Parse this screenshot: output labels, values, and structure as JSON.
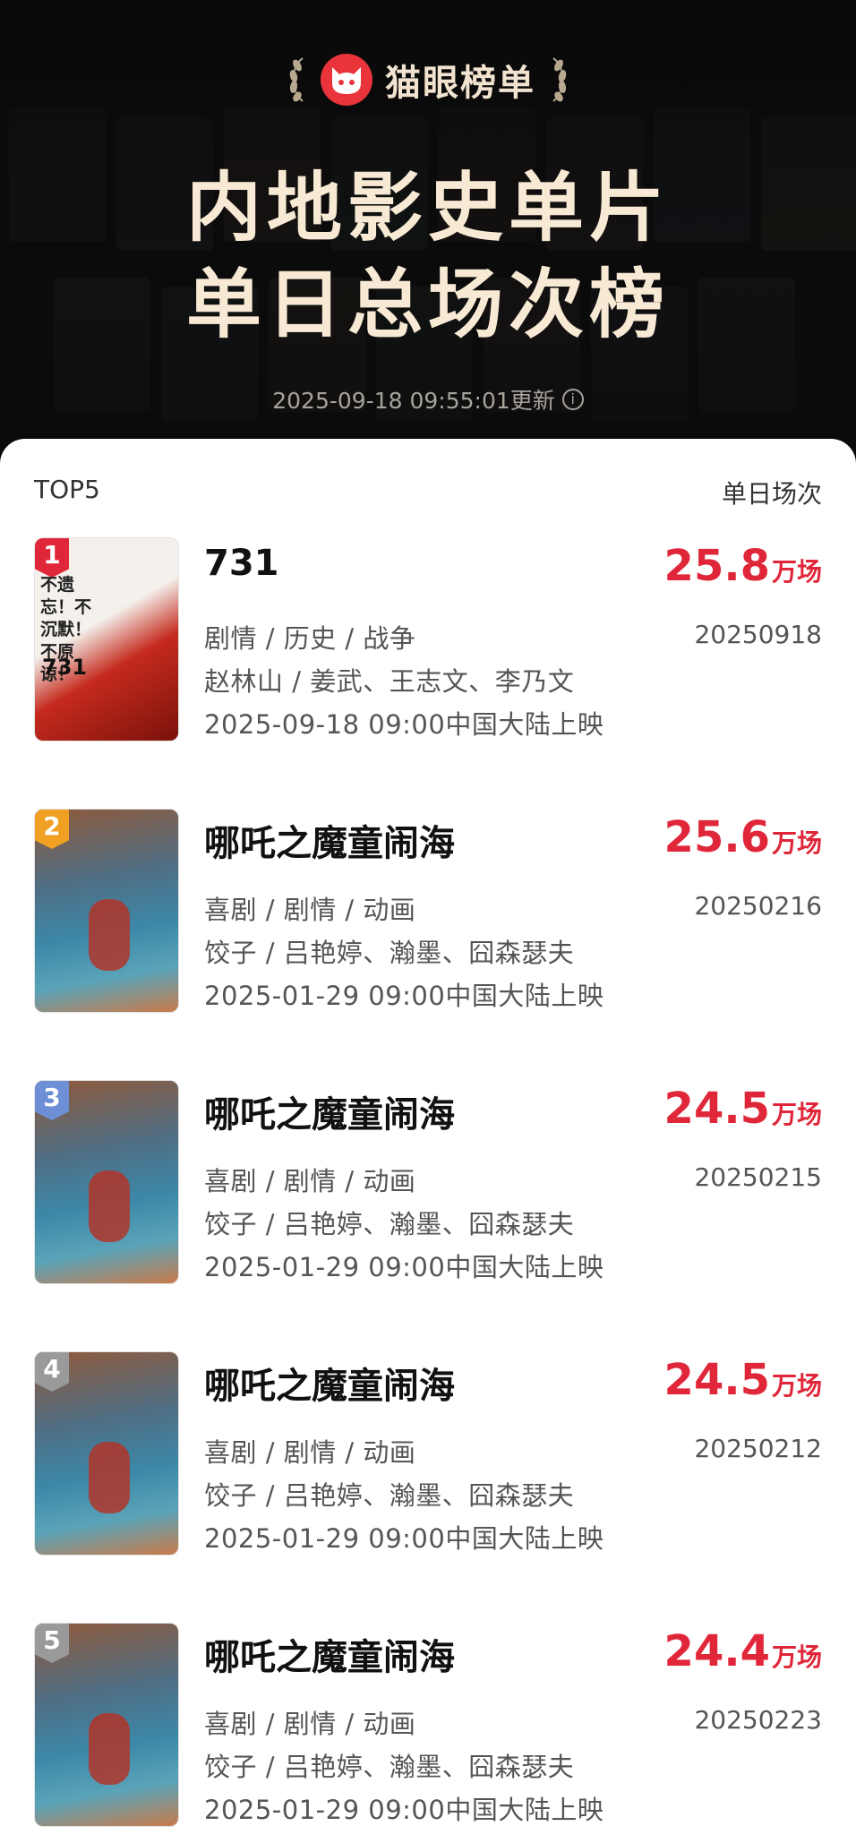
{
  "header": {
    "brand": "猫眼榜单",
    "title_line1": "内地影史单片",
    "title_line2": "单日总场次榜",
    "updated": "2025-09-18 09:55:01更新"
  },
  "list": {
    "label_left": "TOP5",
    "label_right": "单日场次",
    "items": [
      {
        "rank": "1",
        "title": "731",
        "value": "25.8",
        "unit": "万场",
        "date": "20250918",
        "genres": "剧情 / 历史 / 战争",
        "cast": "赵林山 / 姜武、王志文、李乃文",
        "release": "2025-09-18 09:00中国大陆上映",
        "rank_color": "#e0273a"
      },
      {
        "rank": "2",
        "title": "哪吒之魔童闹海",
        "value": "25.6",
        "unit": "万场",
        "date": "20250216",
        "genres": "喜剧 / 剧情 / 动画",
        "cast": "饺子 / 吕艳婷、瀚墨、囧森瑟夫",
        "release": "2025-01-29 09:00中国大陆上映",
        "rank_color": "#f0a022"
      },
      {
        "rank": "3",
        "title": "哪吒之魔童闹海",
        "value": "24.5",
        "unit": "万场",
        "date": "20250215",
        "genres": "喜剧 / 剧情 / 动画",
        "cast": "饺子 / 吕艳婷、瀚墨、囧森瑟夫",
        "release": "2025-01-29 09:00中国大陆上映",
        "rank_color": "#6c8fd6"
      },
      {
        "rank": "4",
        "title": "哪吒之魔童闹海",
        "value": "24.5",
        "unit": "万场",
        "date": "20250212",
        "genres": "喜剧 / 剧情 / 动画",
        "cast": "饺子 / 吕艳婷、瀚墨、囧森瑟夫",
        "release": "2025-01-29 09:00中国大陆上映",
        "rank_color": "#9a9a9a"
      },
      {
        "rank": "5",
        "title": "哪吒之魔童闹海",
        "value": "24.4",
        "unit": "万场",
        "date": "20250223",
        "genres": "喜剧 / 剧情 / 动画",
        "cast": "饺子 / 吕艳婷、瀚墨、囧森瑟夫",
        "release": "2025-01-29 09:00中国大陆上映",
        "rank_color": "#9a9a9a"
      }
    ]
  },
  "icons": {
    "logo": "maoyan-cat-icon",
    "laurel": "laurel-icon",
    "info": "info-icon"
  },
  "colors": {
    "accent": "#e0273a",
    "header_bg": "#0e0e0e",
    "title": "#f7e9d4"
  }
}
